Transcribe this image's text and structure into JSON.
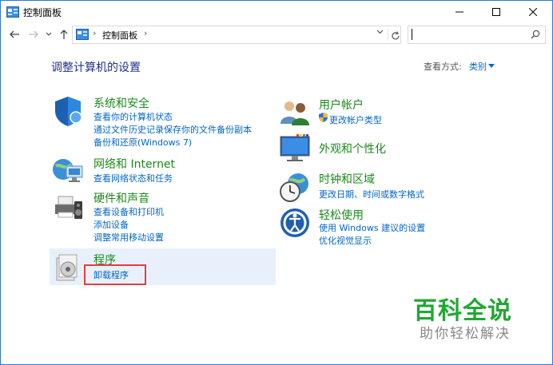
{
  "window": {
    "title": "控制面板"
  },
  "address": {
    "crumb": "控制面板",
    "separator": "›"
  },
  "search": {
    "placeholder": ""
  },
  "heading": "调整计算机的设置",
  "view_by": {
    "label": "查看方式:",
    "value": "类别"
  },
  "categories": [
    {
      "title": "系统和安全",
      "links": [
        "查看你的计算机状态",
        "通过文件历史记录保存你的文件备份副本",
        "备份和还原(Windows 7)"
      ]
    },
    {
      "title": "网络和 Internet",
      "links": [
        "查看网络状态和任务"
      ]
    },
    {
      "title": "硬件和声音",
      "links": [
        "查看设备和打印机",
        "添加设备",
        "调整常用移动设置"
      ]
    },
    {
      "title": "程序",
      "links": [
        "卸载程序"
      ]
    },
    {
      "title": "用户帐户",
      "links": [
        "更改帐户类型"
      ]
    },
    {
      "title": "外观和个性化",
      "links": []
    },
    {
      "title": "时钟和区域",
      "links": [
        "更改日期、时间或数字格式"
      ]
    },
    {
      "title": "轻松使用",
      "links": [
        "使用 Windows 建议的设置",
        "优化视觉显示"
      ]
    }
  ],
  "watermark": {
    "title": "百科全说",
    "subtitle": "助你轻松解决"
  },
  "colors": {
    "accent": "#0066cc",
    "category_title": "#1a8a1a",
    "heading": "#1e3287",
    "highlight": "#e8f1fb",
    "annotation": "#e53f3f"
  }
}
